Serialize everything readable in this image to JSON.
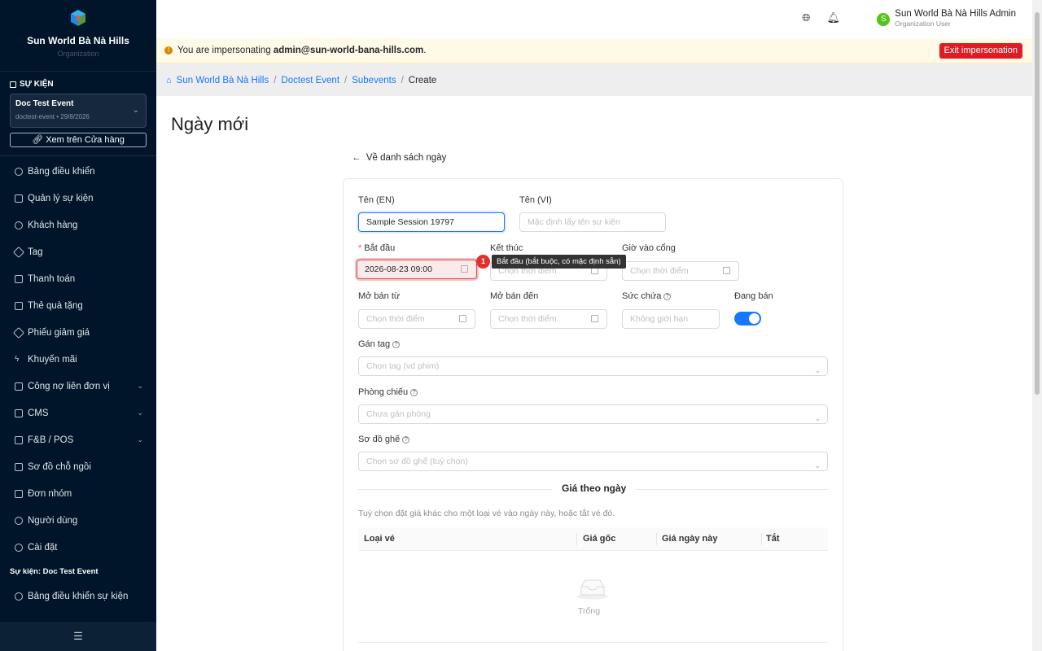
{
  "org": {
    "name": "Sun World Bà Nà Hills",
    "type": "Organization"
  },
  "sidebar": {
    "section_event": "SỰ KIỆN",
    "event_name": "Doc Test Event",
    "event_meta": "doctest-event • 29/8/2026",
    "store_link": "Xem trên Cửa hàng",
    "items": [
      {
        "label": "Bảng điều khiển",
        "icon": "dashboard-icon"
      },
      {
        "label": "Quản lý sự kiện",
        "icon": "calendar-icon"
      },
      {
        "label": "Khách hàng",
        "icon": "user-icon"
      },
      {
        "label": "Tag",
        "icon": "tag-icon"
      },
      {
        "label": "Thanh toán",
        "icon": "payment-icon"
      },
      {
        "label": "Thẻ quà tặng",
        "icon": "gift-icon"
      },
      {
        "label": "Phiếu giảm giá",
        "icon": "coupon-icon"
      },
      {
        "label": "Khuyến mãi",
        "icon": "promo-icon"
      },
      {
        "label": "Công nợ liên đơn vị",
        "icon": "debt-icon"
      },
      {
        "label": "CMS",
        "icon": "cms-icon"
      },
      {
        "label": "F&B / POS",
        "icon": "pos-icon"
      },
      {
        "label": "Sơ đồ chỗ ngồi",
        "icon": "seatmap-icon"
      },
      {
        "label": "Đơn nhóm",
        "icon": "group-icon"
      },
      {
        "label": "Người dùng",
        "icon": "user-icon"
      },
      {
        "label": "Cài đặt",
        "icon": "gear-icon"
      }
    ],
    "section_event2": "Sự kiện: Doc Test Event",
    "event_items": [
      {
        "label": "Bảng điều khiển sự kiện",
        "icon": "dashboard-icon"
      }
    ]
  },
  "topbar": {
    "user_name": "Sun World Bà Nà Hills Admin",
    "user_role": "Organization User",
    "avatar_letter": "S"
  },
  "impersonation": {
    "prefix": "You are impersonating",
    "email": "admin@sun-world-bana-hills.com",
    "suffix": ".",
    "exit_label": "Exit impersonation"
  },
  "breadcrumb": {
    "home": "Sun World Bà Nà Hills",
    "event": "Doctest Event",
    "subevents": "Subevents",
    "current": "Create"
  },
  "page": {
    "title": "Ngày mới",
    "back": "Về danh sách ngày"
  },
  "form": {
    "name_en_label": "Tên (EN)",
    "name_en_value": "Sample Session 19797",
    "name_vi_label": "Tên (VI)",
    "name_vi_placeholder": "Mặc định lấy tên sự kiện",
    "start_label": "Bắt đầu",
    "start_value": "2026-08-23 09:00",
    "end_label": "Kết thúc",
    "end_placeholder": "Chọn thời điểm",
    "gate_label": "Giờ vào cổng",
    "gate_placeholder": "Chọn thời điểm",
    "sale_from_label": "Mở bán từ",
    "sale_from_placeholder": "Chọn thời điểm",
    "sale_to_label": "Mở bán đến",
    "sale_to_placeholder": "Chọn thời điểm",
    "capacity_label": "Sức chứa",
    "capacity_placeholder": "Không giới hạn",
    "on_sale_label": "Đang bán",
    "on_sale": true,
    "tag_label": "Gán tag",
    "tag_placeholder": "Chọn tag (vd phim)",
    "room_label": "Phòng chiếu",
    "room_placeholder": "Chưa gán phòng",
    "seatmap_label": "Sơ đồ ghế",
    "seatmap_placeholder": "Chọn sơ đồ ghế (tuỳ chọn)",
    "tooltip": "Bắt đầu (bắt buộc, có mặc định sẵn)",
    "badge": "1"
  },
  "pricing": {
    "title": "Giá theo ngày",
    "desc": "Tuỳ chọn đặt giá khác cho một loại vé vào ngày này, hoặc tắt vé đó.",
    "columns": [
      "Loại vé",
      "Giá gốc",
      "Giá ngày này",
      "Tắt"
    ],
    "empty": "Trống"
  },
  "colors": {
    "sidebar": "#001529",
    "primary": "#1677ff",
    "danger": "#e01b24",
    "warning_bg": "#fff9e8"
  }
}
